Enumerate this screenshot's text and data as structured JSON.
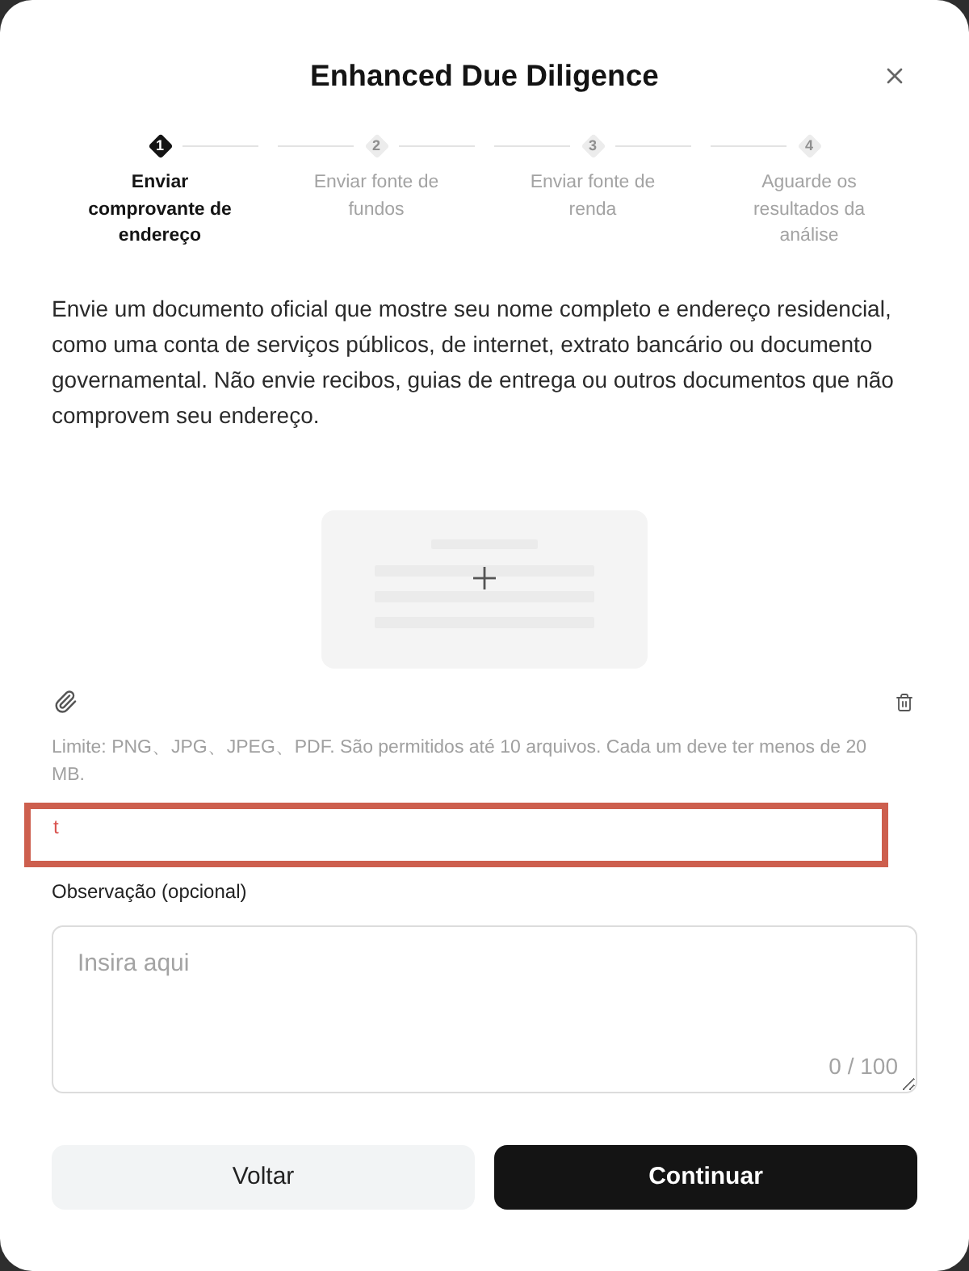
{
  "dialog": {
    "title": "Enhanced Due Diligence"
  },
  "steps": [
    {
      "number": "1",
      "label": "Enviar comprovante de endereço",
      "selected": true
    },
    {
      "number": "2",
      "label": "Enviar fonte de fundos",
      "selected": false
    },
    {
      "number": "3",
      "label": "Enviar fonte de renda",
      "selected": false
    },
    {
      "number": "4",
      "label": "Aguarde os resultados da análise",
      "selected": false
    }
  ],
  "description": "Envie um documento oficial que mostre seu nome completo e endereço residencial, como uma conta de serviços públicos, de internet, extrato bancário ou documento governamental. Não envie recibos, guias de entrega ou outros documentos que não comprovem seu endereço.",
  "upload": {
    "hint": "Limite: PNG、JPG、JPEG、PDF. São permitidos até 10 arquivos. Cada um deve ter menos de 20 MB.",
    "error": "t"
  },
  "note": {
    "label": "Observação (opcional)",
    "placeholder": "Insira aqui",
    "counter": "0 / 100"
  },
  "buttons": [
    {
      "label": "Voltar",
      "kind": "secondary"
    },
    {
      "label": "Continuar",
      "kind": "primary"
    }
  ]
}
